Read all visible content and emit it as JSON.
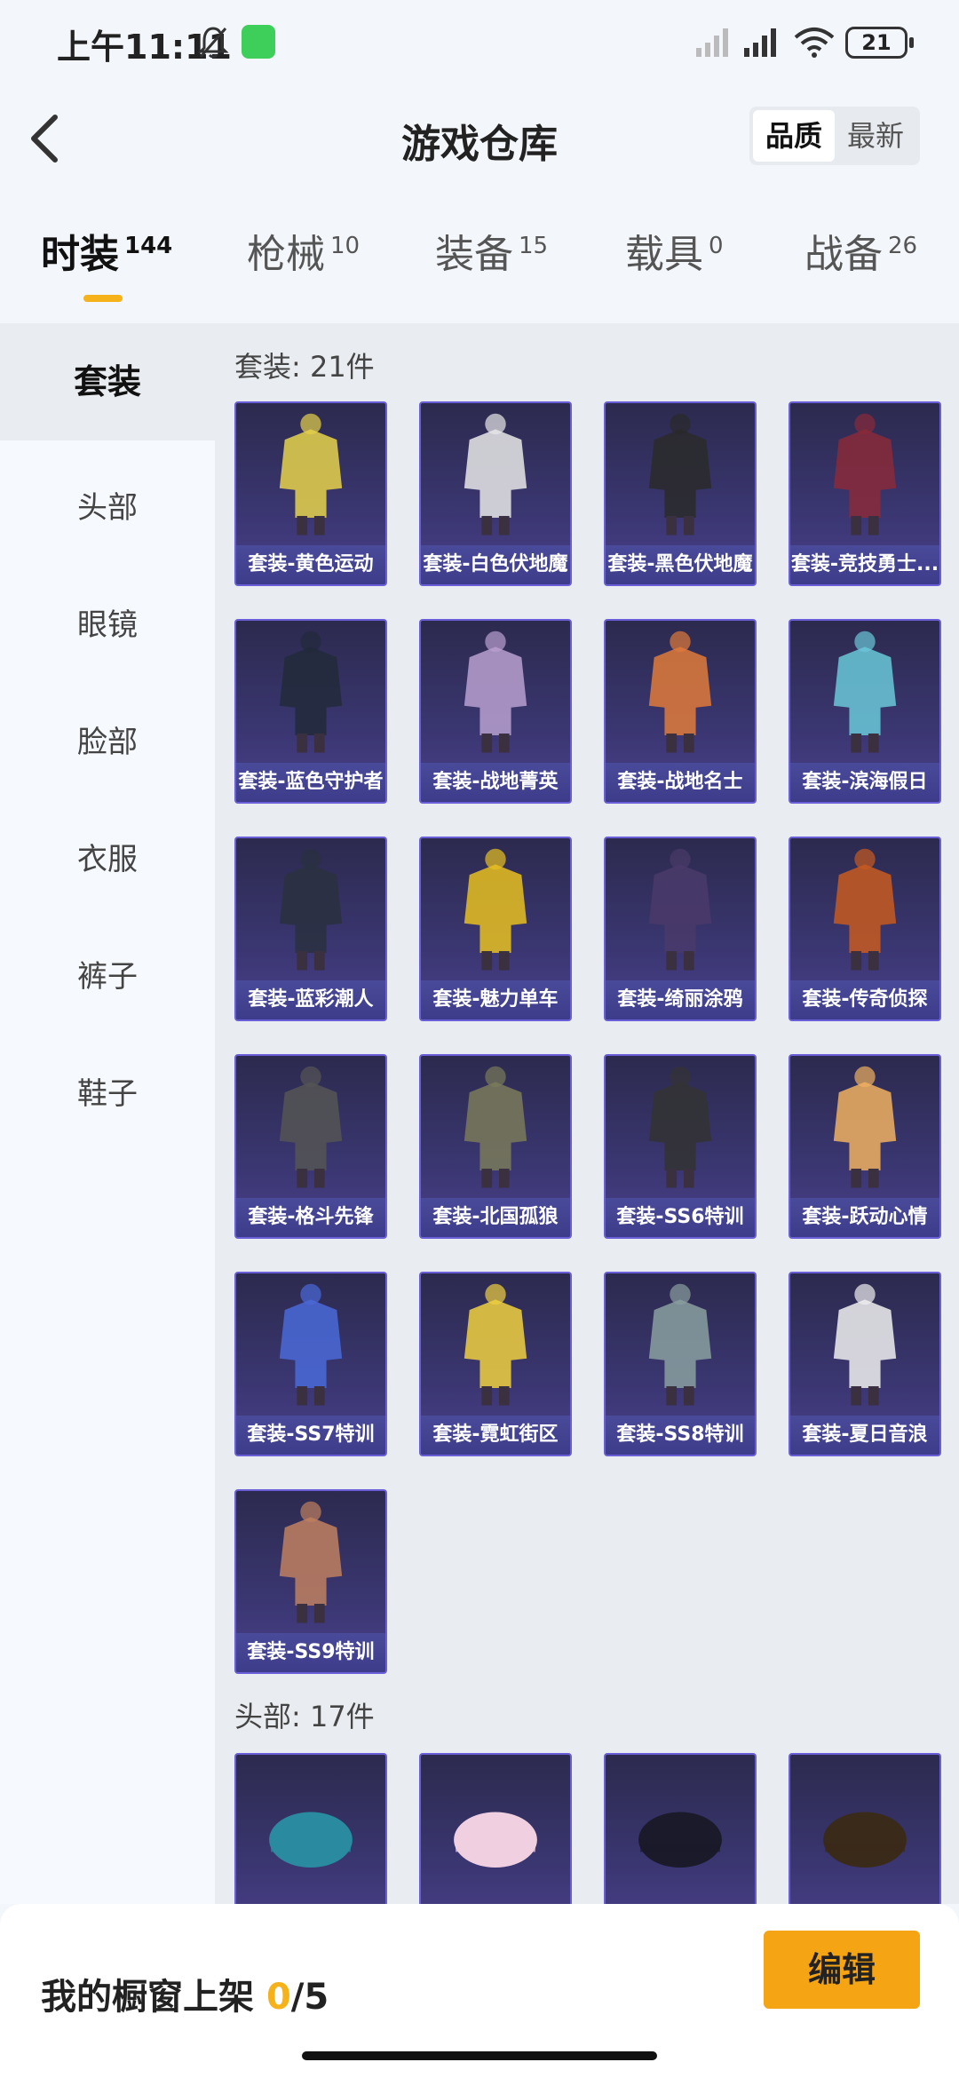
{
  "status_bar": {
    "time": "上午11:11",
    "battery": "21"
  },
  "header": {
    "title": "游戏仓库",
    "sort_options": [
      "品质",
      "最新"
    ],
    "active_sort": 0
  },
  "tabs": [
    {
      "label": "时装",
      "count": "144"
    },
    {
      "label": "枪械",
      "count": "10"
    },
    {
      "label": "装备",
      "count": "15"
    },
    {
      "label": "载具",
      "count": "0"
    },
    {
      "label": "战备",
      "count": "26"
    }
  ],
  "sidebar": {
    "items": [
      "套装",
      "头部",
      "眼镜",
      "脸部",
      "衣服",
      "裤子",
      "鞋子"
    ]
  },
  "sections": [
    {
      "title": "套装: 21件",
      "items": [
        "套装-黄色运动",
        "套装-白色伏地魔",
        "套装-黑色伏地魔",
        "套装-竞技勇士...",
        "套装-蓝色守护者",
        "套装-战地菁英",
        "套装-战地名士",
        "套装-滨海假日",
        "套装-蓝彩潮人",
        "套装-魅力单车",
        "套装-绮丽涂鸦",
        "套装-传奇侦探",
        "套装-格斗先锋",
        "套装-北国孤狼",
        "套装-SS6特训",
        "套装-跃动心情",
        "套装-SS7特训",
        "套装-霓虹街区",
        "套装-SS8特训",
        "套装-夏日音浪",
        "套装-SS9特训"
      ]
    },
    {
      "title": "头部: 17件"
    }
  ],
  "bottom_bar": {
    "label": "我的橱窗上架 ",
    "current": "0",
    "total": "/5",
    "edit": "编辑"
  },
  "colors": {
    "accent": "#f5b21a",
    "card_bg": "#3a3671",
    "card_border": "#6a5fd8"
  }
}
